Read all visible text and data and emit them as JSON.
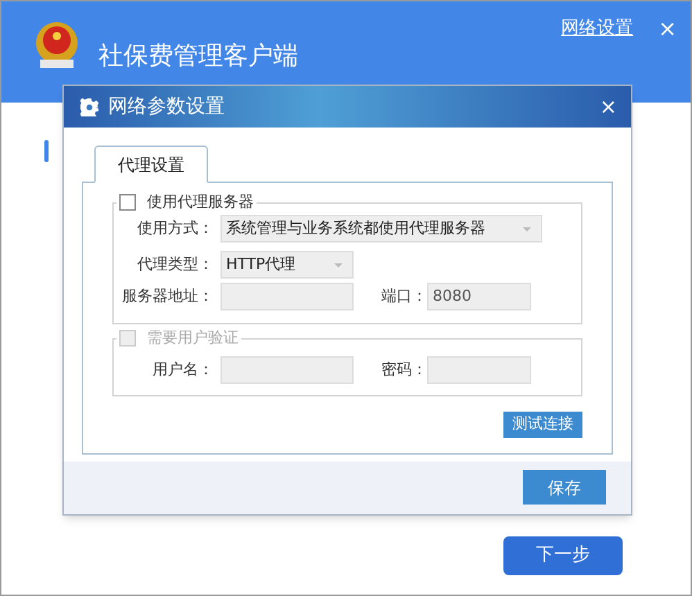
{
  "app": {
    "title": "社保费管理客户端",
    "network_link": "网络设置",
    "close": "×"
  },
  "dialog": {
    "title": "网络参数设置",
    "close": "×",
    "tabs": [
      {
        "label": "代理设置",
        "selected": true
      }
    ],
    "proxy_group": {
      "label": "使用代理服务器",
      "checked": false,
      "disabled": false,
      "mode": {
        "label": "使用方式：",
        "value": "系统管理与业务系统都使用代理服务器"
      },
      "type": {
        "label": "代理类型：",
        "value": "HTTP代理"
      },
      "address": {
        "label": "服务器地址："
      },
      "port": {
        "label": "端口：",
        "value": "8080"
      }
    },
    "auth_group": {
      "label": "需要用户验证",
      "checked": false,
      "disabled": true,
      "username": {
        "label": "用户名："
      },
      "password": {
        "label": "密码："
      }
    },
    "test_button": "测试连接",
    "save_button": "保存"
  },
  "next_button": "下一步"
}
